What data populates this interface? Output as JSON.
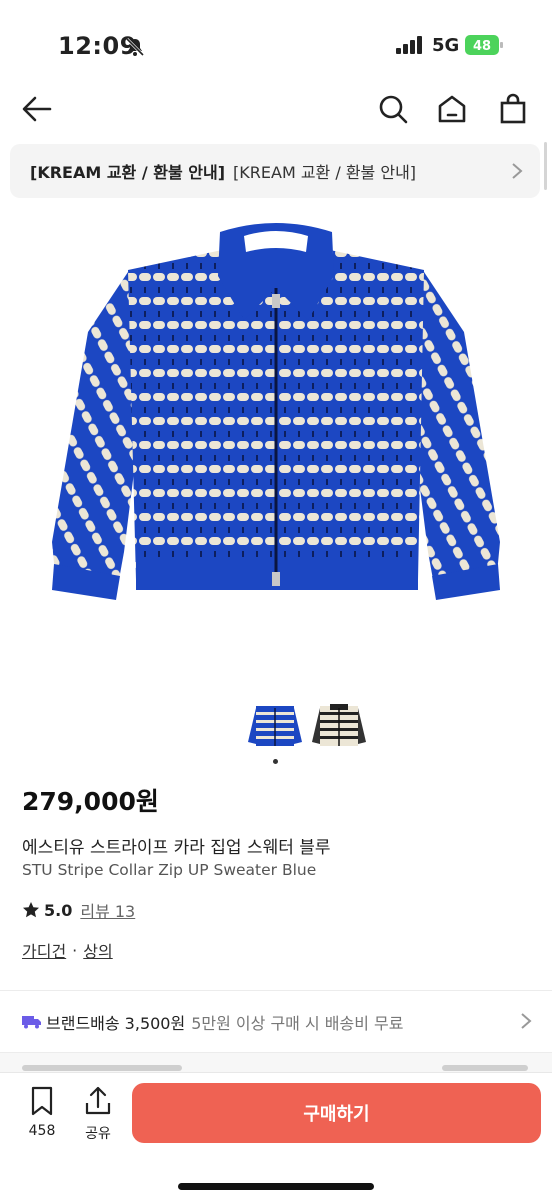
{
  "status_bar": {
    "time": "12:09",
    "network": "5G",
    "battery": "48"
  },
  "notice": {
    "bold": "[KREAM 교환 / 환불 안내]",
    "text": "[KREAM 교환 / 환불 안내]"
  },
  "product": {
    "price": "279,000원",
    "name_ko": "에스티유 스트라이프 카라 집업 스웨터 블루",
    "name_en": "STU Stripe Collar Zip UP Sweater Blue",
    "rating": "5.0",
    "review_text": "리뷰 13",
    "categories": [
      "가디건",
      "상의"
    ],
    "category_separator": "·",
    "colors": {
      "blue": "#1c47c2",
      "cream": "#ece6d6"
    }
  },
  "shipping": {
    "label": "브랜드배송 3,500원",
    "desc": "5만원 이상 구매 시 배송비 무료"
  },
  "bottom_bar": {
    "bookmark_count": "458",
    "share_label": "공유",
    "buy_label": "구매하기"
  },
  "colors": {
    "accent": "#ef6253"
  }
}
